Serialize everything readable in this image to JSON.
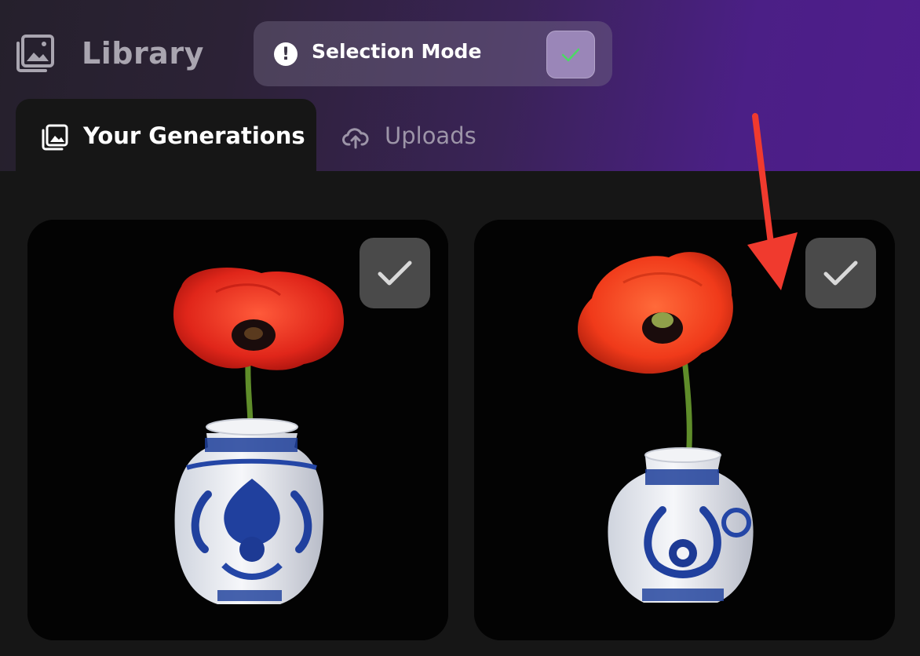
{
  "header": {
    "title": "Library",
    "library_icon": "gallery-icon"
  },
  "selection_mode": {
    "label": "Selection Mode",
    "icon": "exclamation-circle-icon",
    "toggle_icon": "check-icon",
    "toggle_checked": true,
    "check_color": "#4cd964"
  },
  "tabs": [
    {
      "label": "Your Generations",
      "icon": "gallery-icon",
      "active": true
    },
    {
      "label": "Uploads",
      "icon": "cloud-upload-icon",
      "active": false
    }
  ],
  "gallery": {
    "items": [
      {
        "subject": "red poppy in blue-and-white porcelain vase",
        "selected_check_icon": "check-icon"
      },
      {
        "subject": "red poppy in blue-and-white porcelain vase",
        "selected_check_icon": "check-icon"
      }
    ]
  },
  "annotation": {
    "arrow_color": "#f03a2e"
  },
  "colors": {
    "accent_purple": "#4f1d8c",
    "background": "#161616"
  }
}
